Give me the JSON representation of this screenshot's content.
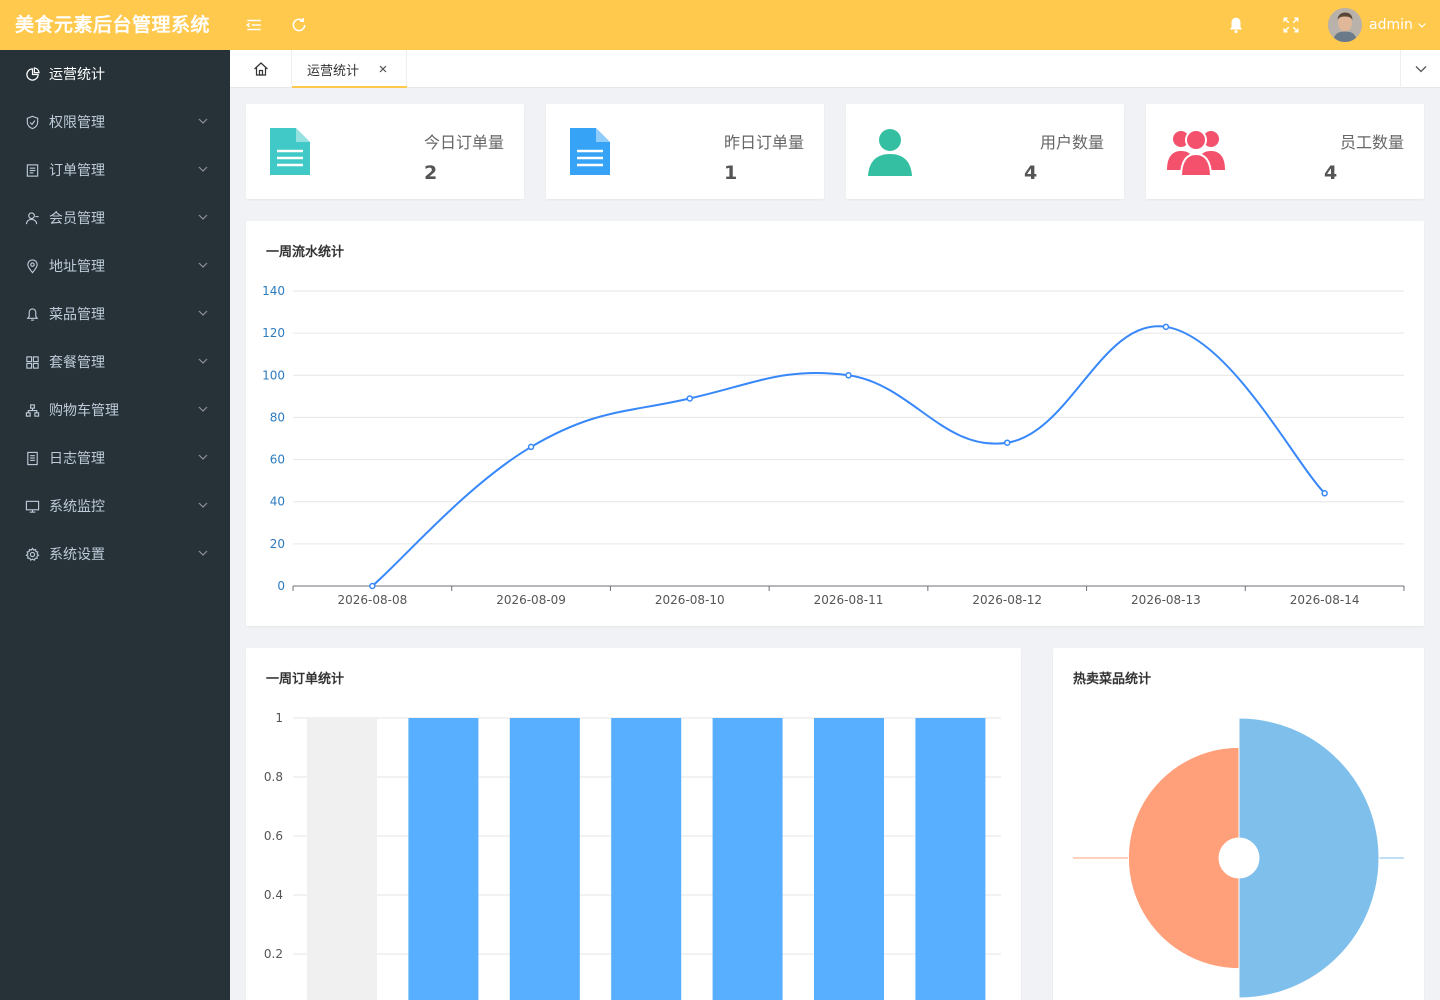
{
  "app": {
    "title": "美食元素后台管理系统"
  },
  "header": {
    "user_name": "admin",
    "icons": [
      "menu-fold-icon",
      "refresh-icon",
      "bell-icon",
      "fullscreen-icon",
      "avatar",
      "chevron-down-icon"
    ]
  },
  "sidebar": {
    "items": [
      {
        "label": "运营统计",
        "icon": "pie-chart-icon",
        "active": true
      },
      {
        "label": "权限管理",
        "icon": "shield-icon"
      },
      {
        "label": "订单管理",
        "icon": "list-icon"
      },
      {
        "label": "会员管理",
        "icon": "user-icon"
      },
      {
        "label": "地址管理",
        "icon": "location-icon"
      },
      {
        "label": "菜品管理",
        "icon": "bell-icon"
      },
      {
        "label": "套餐管理",
        "icon": "grid-icon"
      },
      {
        "label": "购物车管理",
        "icon": "org-chart-icon"
      },
      {
        "label": "日志管理",
        "icon": "document-icon"
      },
      {
        "label": "系统监控",
        "icon": "monitor-icon"
      },
      {
        "label": "系统设置",
        "icon": "gear-icon"
      }
    ]
  },
  "tabs": {
    "items": [
      {
        "label": "运营统计"
      }
    ]
  },
  "stats": [
    {
      "label": "今日订单量",
      "value": "2",
      "icon": "document-icon",
      "color": "#40c9c6"
    },
    {
      "label": "昨日订单量",
      "value": "1",
      "icon": "document-icon",
      "color": "#36a3f7"
    },
    {
      "label": "用户数量",
      "value": "4",
      "icon": "user-icon",
      "color": "#34bfa3"
    },
    {
      "label": "员工数量",
      "value": "4",
      "icon": "team-icon",
      "color": "#f4516c"
    }
  ],
  "panels": {
    "revenue_title": "一周流水统计",
    "orders_title": "一周订单统计",
    "hot_title": "热卖菜品统计"
  },
  "chart_data": [
    {
      "type": "line",
      "title": "一周流水统计",
      "x": [
        "2026-08-08",
        "2026-08-09",
        "2026-08-10",
        "2026-08-11",
        "2026-08-12",
        "2026-08-13",
        "2026-08-14"
      ],
      "values": [
        0,
        66,
        89,
        100,
        68,
        123,
        44
      ],
      "ylim": [
        0,
        140
      ],
      "yticks": [
        0,
        20,
        40,
        60,
        80,
        100,
        120,
        140
      ],
      "color": "#3888fa",
      "grid": true
    },
    {
      "type": "bar",
      "title": "一周订单统计",
      "values": [
        0,
        1,
        1,
        1,
        1,
        1,
        1
      ],
      "ylim": [
        0,
        1
      ],
      "yticks": [
        "1",
        "0.8",
        "0.6",
        "0.4",
        "0.2"
      ],
      "color": "#58afff",
      "background_color": "#f0f0f0",
      "grid": true
    },
    {
      "type": "pie",
      "title": "热卖菜品统计",
      "style": "rose",
      "slices": [
        {
          "value": 1.0,
          "color": "#7ebfec"
        },
        {
          "value": 0.79,
          "color": "#ffa07a"
        }
      ]
    }
  ]
}
